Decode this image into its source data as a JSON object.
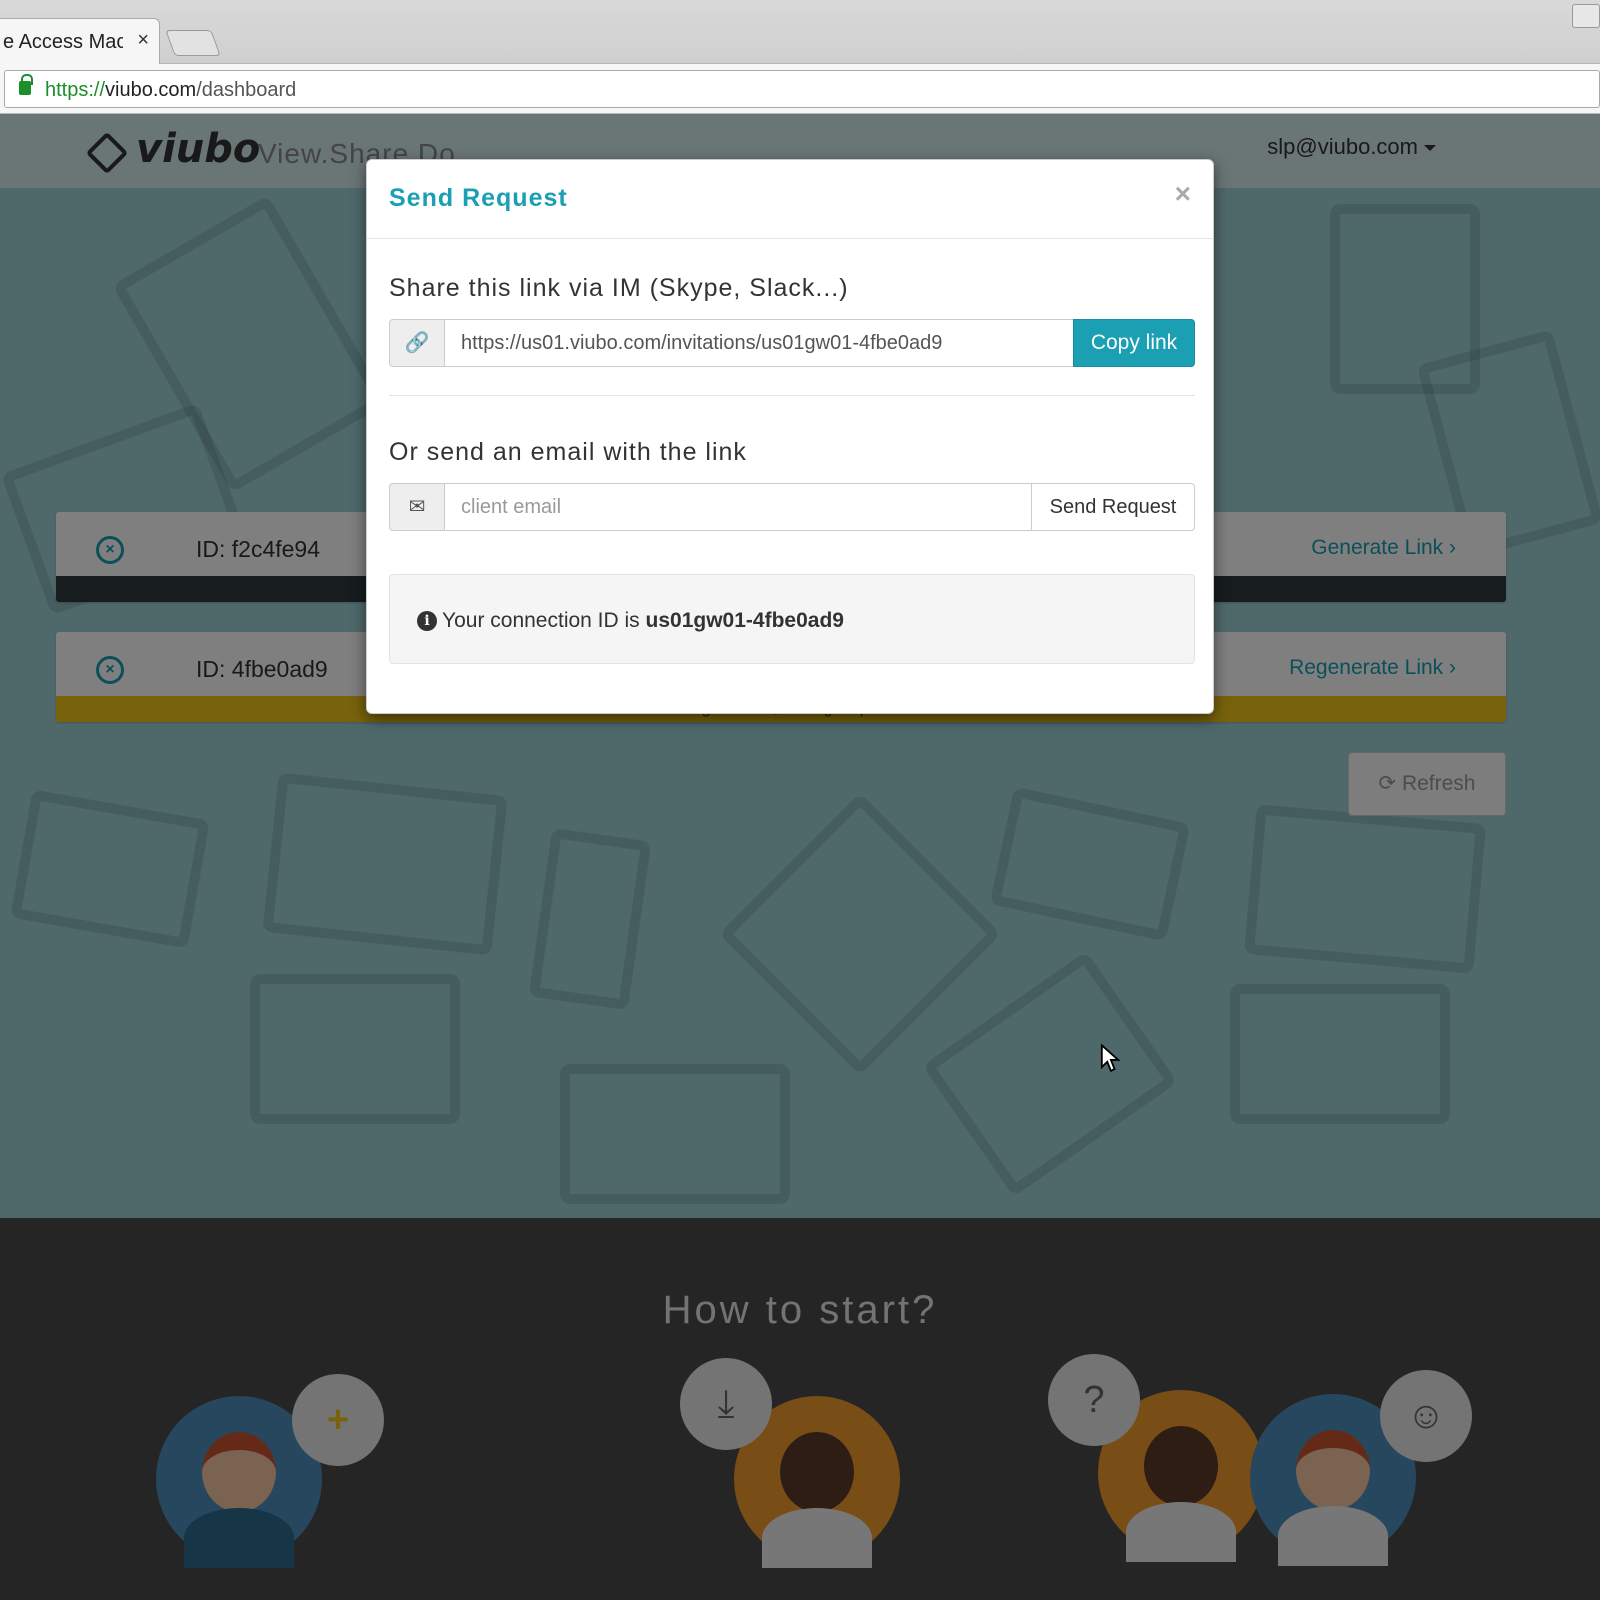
{
  "browser": {
    "tab_title": "e Access Mac",
    "tab_close": "×",
    "url_scheme": "https://",
    "url_host": "viubo.com",
    "url_path": "/dashboard"
  },
  "site": {
    "logo_text": "viubo",
    "tagline": "View.Share.Do",
    "user_email": "slp@viubo.com"
  },
  "connections": [
    {
      "id_label": "ID: f2c4fe94",
      "action": "Generate Link",
      "status": "",
      "status_color": "#2f3a3c"
    },
    {
      "id_label": "ID: 4fbe0ad9",
      "action": "Regenerate Link",
      "status": "Link generated, waiting for peer",
      "status_color": "#f0c419"
    }
  ],
  "refresh_label": "Refresh",
  "footer": {
    "title": "How to start?",
    "bubbles": [
      "+",
      "⤓",
      "?",
      "☺"
    ]
  },
  "modal": {
    "title": "Send Request",
    "close": "×",
    "share_label": "Share this link via IM (Skype, Slack...)",
    "link_value": "https://us01.viubo.com/invitations/us01gw01-4fbe0ad9",
    "copy_button": "Copy link",
    "email_label": "Or send an email with the link",
    "email_placeholder": "client email",
    "send_button": "Send Request",
    "info_prefix": "Your connection ID is",
    "connection_id": "us01gw01-4fbe0ad9"
  },
  "colors": {
    "accent": "#1a9fb3",
    "page_bg": "#9fd3d6",
    "footer_bg": "#4a4a4a"
  }
}
